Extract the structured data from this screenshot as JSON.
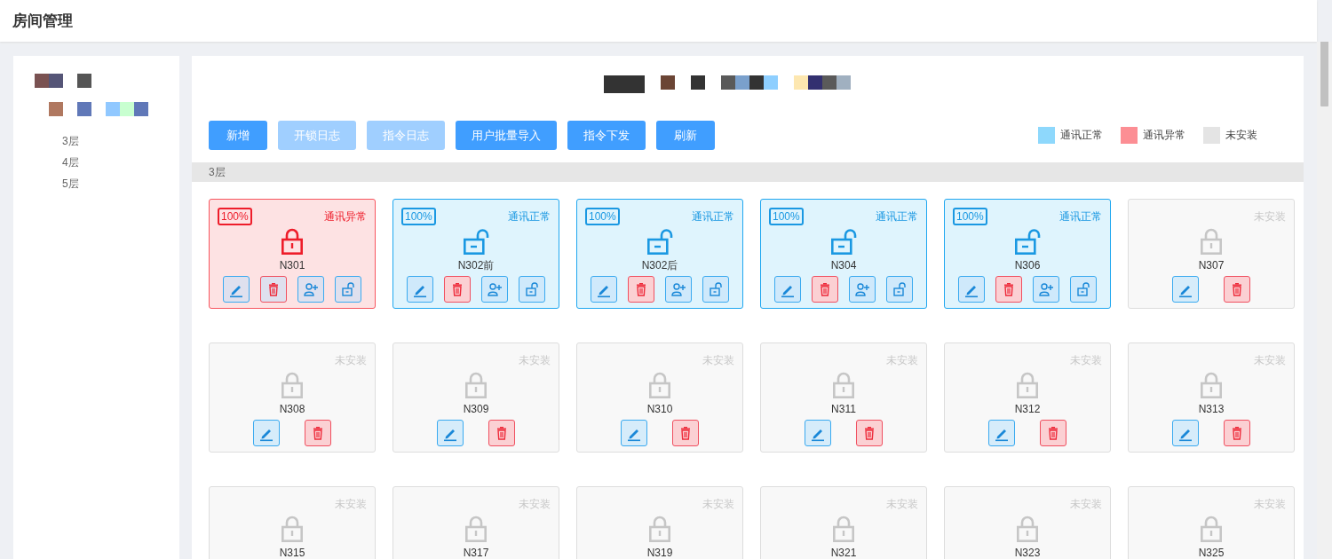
{
  "page_title": "房间管理",
  "sidebar": {
    "items": [
      {
        "label": "3层",
        "selected": false
      },
      {
        "label": "4层",
        "selected": false
      },
      {
        "label": "5层",
        "selected": false
      }
    ]
  },
  "toolbar": {
    "buttons": [
      {
        "label": "新增",
        "disabled": false
      },
      {
        "label": "开锁日志",
        "disabled": true
      },
      {
        "label": "指令日志",
        "disabled": true
      },
      {
        "label": "用户批量导入",
        "disabled": false
      },
      {
        "label": "指令下发",
        "disabled": false
      },
      {
        "label": "刷新",
        "disabled": false
      }
    ]
  },
  "legend": [
    {
      "label": "通讯正常",
      "color": "#8ed8fc"
    },
    {
      "label": "通讯异常",
      "color": "#fc8e94"
    },
    {
      "label": "未安装",
      "color": "#e4e4e4"
    }
  ],
  "floor": {
    "label": "3层",
    "rooms": [
      {
        "name": "N301",
        "kind": "abnormal",
        "battery": "100%",
        "status": "通讯异常",
        "locked": true
      },
      {
        "name": "N302前",
        "kind": "normal",
        "battery": "100%",
        "status": "通讯正常",
        "locked": false
      },
      {
        "name": "N302后",
        "kind": "normal",
        "battery": "100%",
        "status": "通讯正常",
        "locked": false
      },
      {
        "name": "N304",
        "kind": "normal",
        "battery": "100%",
        "status": "通讯正常",
        "locked": false
      },
      {
        "name": "N306",
        "kind": "normal",
        "battery": "100%",
        "status": "通讯正常",
        "locked": false
      },
      {
        "name": "N307",
        "kind": "not_installed",
        "status": "未安装",
        "locked": true
      },
      {
        "name": "N308",
        "kind": "not_installed",
        "status": "未安装",
        "locked": true
      },
      {
        "name": "N309",
        "kind": "not_installed",
        "status": "未安装",
        "locked": true
      },
      {
        "name": "N310",
        "kind": "not_installed",
        "status": "未安装",
        "locked": true
      },
      {
        "name": "N311",
        "kind": "not_installed",
        "status": "未安装",
        "locked": true
      },
      {
        "name": "N312",
        "kind": "not_installed",
        "status": "未安装",
        "locked": true
      },
      {
        "name": "N313",
        "kind": "not_installed",
        "status": "未安装",
        "locked": true
      },
      {
        "name": "N315",
        "kind": "not_installed",
        "status": "未安装",
        "locked": true
      },
      {
        "name": "N317",
        "kind": "not_installed",
        "status": "未安装",
        "locked": true
      },
      {
        "name": "N319",
        "kind": "not_installed",
        "status": "未安装",
        "locked": true
      },
      {
        "name": "N321",
        "kind": "not_installed",
        "status": "未安装",
        "locked": true
      },
      {
        "name": "N323",
        "kind": "not_installed",
        "status": "未安装",
        "locked": true
      },
      {
        "name": "N325",
        "kind": "not_installed",
        "status": "未安装",
        "locked": true
      }
    ]
  }
}
